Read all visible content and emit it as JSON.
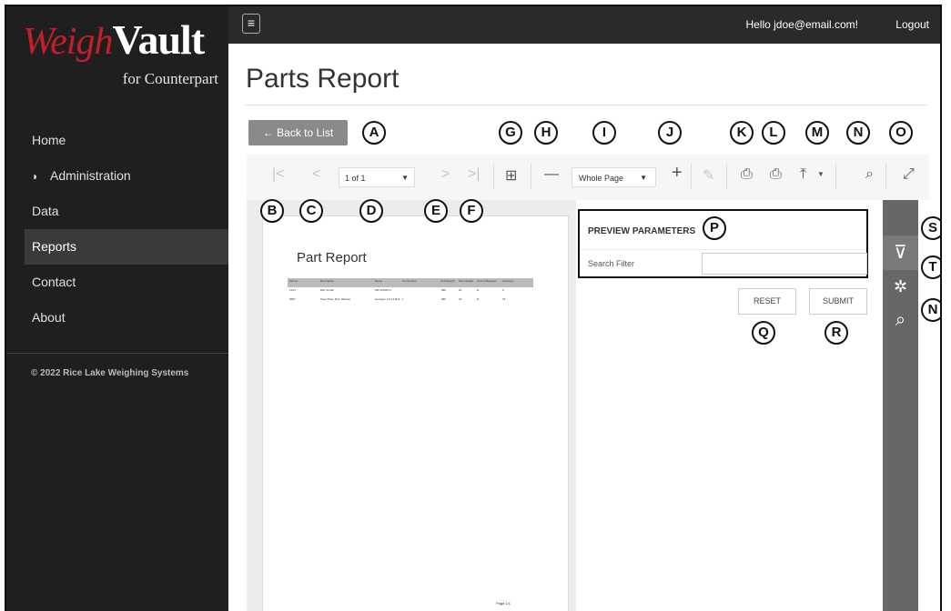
{
  "logo": {
    "brand_script": "Weigh",
    "brand_bold": "Vault",
    "tagline": "for Counterpart"
  },
  "topbar": {
    "greeting": "Hello jdoe@email.com!",
    "logout": "Logout",
    "menu_glyph": "≡"
  },
  "sidebar": {
    "items": [
      {
        "label": "Home",
        "icon": ""
      },
      {
        "label": "Administration",
        "icon": "shield-icon"
      },
      {
        "label": "Data",
        "icon": ""
      },
      {
        "label": "Reports",
        "icon": "",
        "active": true
      },
      {
        "label": "Contact",
        "icon": ""
      },
      {
        "label": "About",
        "icon": ""
      }
    ],
    "shield_glyph": "◗",
    "copyright": "© 2022 Rice Lake Weighing Systems"
  },
  "page": {
    "title": "Parts Report",
    "back_button": "← Back to List"
  },
  "toolbar": {
    "first_page_glyph": "|<",
    "prev_page_glyph": "<",
    "page_indicator": "1 of 1",
    "next_page_glyph": ">",
    "last_page_glyph": ">|",
    "multipage_glyph": "⊞",
    "zoom_out_glyph": "—",
    "zoom_value": "Whole Page",
    "zoom_in_glyph": "+",
    "highlight_glyph": "✎",
    "print_glyph": "⎙",
    "print_page_glyph": "⎙",
    "export_glyph": "⤒",
    "search_glyph": "⌕",
    "fullscreen_glyph": "⤢",
    "dropdown_glyph": "▼"
  },
  "report_preview": {
    "title": "Part Report",
    "columns": [
      "Part Id",
      "Description",
      "Name",
      "Lot Number",
      "Unit Weight",
      "Tare Weight",
      "Unit of Measure",
      "Inventory"
    ],
    "rows": [
      [
        "1234",
        "Bolt (small)",
        "AB 123456 m",
        "",
        ".098",
        "20",
        "lb",
        "0"
      ],
      [
        "5687",
        "Steel Plate, Bolt, Washer",
        "Hexagon 1/2-13 Bolt",
        "1",
        ".085",
        "20",
        "lb",
        "15"
      ]
    ],
    "footer": "Page 1/1"
  },
  "parameters": {
    "title": "PREVIEW PARAMETERS",
    "search_label": "Search Filter",
    "search_value": "",
    "reset": "RESET",
    "submit": "SUBMIT"
  },
  "side_tabs": {
    "filter_glyph": "⊽",
    "settings_glyph": "✲",
    "search_glyph": "⌕"
  },
  "callouts": [
    "A",
    "B",
    "C",
    "D",
    "E",
    "F",
    "G",
    "H",
    "I",
    "J",
    "K",
    "L",
    "M",
    "N",
    "O",
    "P",
    "Q",
    "R",
    "S",
    "T",
    "N"
  ],
  "colors": {
    "sidebar_bg": "#1f1f1f",
    "brand_red": "#c41e2a",
    "active_nav": "#3a3a3a",
    "button_gray": "#8a8a8a",
    "side_tab_bg": "#676767"
  }
}
